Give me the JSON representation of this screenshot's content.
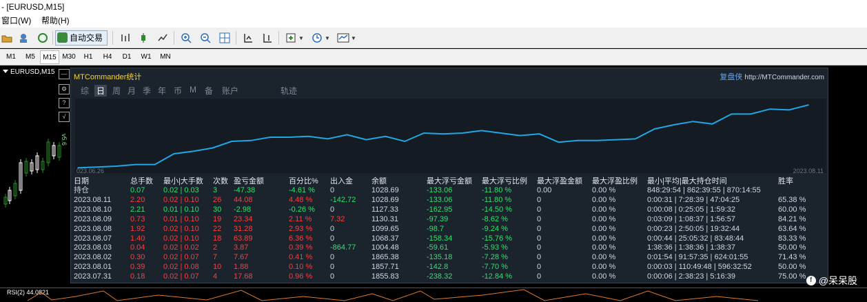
{
  "window": {
    "title": "- [EURUSD,M15]"
  },
  "menu": {
    "items": [
      {
        "label": "窗口(W)"
      },
      {
        "label": "帮助(H)"
      }
    ]
  },
  "toolbar": {
    "autotrade_label": "自动交易"
  },
  "timeframes": [
    "M1",
    "M5",
    "M15",
    "M30",
    "H1",
    "H4",
    "D1",
    "W1",
    "MN"
  ],
  "selected_timeframe": "M15",
  "chart": {
    "symbol_label": "EURUSD,M15",
    "vertical_text": "v5.6",
    "rsi_label": "RSI(2) 44.0821"
  },
  "panel": {
    "title": "MTCommander统计",
    "brand": "复盘侠",
    "brand_url": "http://MTCommander.com",
    "tabs": [
      "综",
      "日",
      "周",
      "月",
      "季",
      "年",
      "币",
      "M",
      "备",
      "账户",
      "轨迹"
    ],
    "active_tab": "日",
    "x_start": "023.06.26",
    "x_end": "2023.08.11"
  },
  "chart_data": {
    "type": "line",
    "x": [
      "2023.06.26",
      "2023.08.11"
    ],
    "values": [
      3,
      4,
      5,
      7,
      7,
      20,
      23,
      27,
      35,
      36,
      40,
      40,
      41,
      38,
      43,
      37,
      41,
      35,
      45,
      44,
      45,
      48,
      45,
      42,
      44,
      34,
      36,
      36,
      37,
      38,
      50,
      55,
      59,
      56,
      68,
      68,
      74,
      73,
      79
    ],
    "color": "#1fa7e6"
  },
  "table": {
    "headers": [
      "日期",
      "总手数",
      "最小|大手数",
      "次数",
      "盈亏金额",
      "百分比%",
      "出入金",
      "余额",
      "最大浮亏金额",
      "最大浮亏比例",
      "最大浮盈金额",
      "最大浮盈比例",
      "最小|平均|最大持仓时间",
      "胜率"
    ],
    "rows": [
      {
        "date": "持仓",
        "lots": "0.07",
        "minmax": "0.02 | 0.03",
        "count": "3",
        "pnl": "-47.38",
        "pct": "-4.61 %",
        "flow": "0",
        "balance": "1028.69",
        "maxloss": "-133.06",
        "maxlosspct": "-11.80 %",
        "maxprofit": "0.00",
        "maxprofitpct": "0.00 %",
        "hold": "848:29:54 | 862:39:55 | 870:14:55",
        "win": "",
        "color": "g"
      },
      {
        "date": "2023.08.11",
        "lots": "2.20",
        "minmax": "0.02 | 0.10",
        "count": "26",
        "pnl": "44.08",
        "pct": "4.48 %",
        "flow": "-142.72",
        "balance": "1028.69",
        "maxloss": "-133.06",
        "maxlosspct": "-11.80 %",
        "maxprofit": "0",
        "maxprofitpct": "0.00 %",
        "hold": "0:00:31 | 7:28:39 | 47:04:25",
        "win": "65.38 %",
        "color": "r"
      },
      {
        "date": "2023.08.10",
        "lots": "2.21",
        "minmax": "0.01 | 0.10",
        "count": "30",
        "pnl": "-2.98",
        "pct": "-0.26 %",
        "flow": "0",
        "balance": "1127.33",
        "maxloss": "-162.95",
        "maxlosspct": "-14.50 %",
        "maxprofit": "0",
        "maxprofitpct": "0.00 %",
        "hold": "0:00:08 | 0:25:05 | 1:59:32",
        "win": "60.00 %",
        "color": "g"
      },
      {
        "date": "2023.08.09",
        "lots": "0.73",
        "minmax": "0.01 | 0.10",
        "count": "19",
        "pnl": "23.34",
        "pct": "2.11 %",
        "flow": "7.32",
        "balance": "1130.31",
        "maxloss": "-97.39",
        "maxlosspct": "-8.62 %",
        "maxprofit": "0",
        "maxprofitpct": "0.00 %",
        "hold": "0:03:09 | 1:08:37 | 1:56:57",
        "win": "84.21 %",
        "color": "r"
      },
      {
        "date": "2023.08.08",
        "lots": "1.92",
        "minmax": "0.02 | 0.10",
        "count": "22",
        "pnl": "31.28",
        "pct": "2.93 %",
        "flow": "0",
        "balance": "1099.65",
        "maxloss": "-98.7",
        "maxlosspct": "-9.24 %",
        "maxprofit": "0",
        "maxprofitpct": "0.00 %",
        "hold": "0:00:23 | 2:50:05 | 19:32:44",
        "win": "63.64 %",
        "color": "r"
      },
      {
        "date": "2023.08.07",
        "lots": "1.40",
        "minmax": "0.02 | 0.10",
        "count": "18",
        "pnl": "63.89",
        "pct": "6.36 %",
        "flow": "0",
        "balance": "1068.37",
        "maxloss": "-158.34",
        "maxlosspct": "-15.76 %",
        "maxprofit": "0",
        "maxprofitpct": "0.00 %",
        "hold": "0:00:44 | 25:05:32 | 83:48:44",
        "win": "83.33 %",
        "color": "r"
      },
      {
        "date": "2023.08.03",
        "lots": "0.04",
        "minmax": "0.02 | 0.02",
        "count": "2",
        "pnl": "3.87",
        "pct": "0.39 %",
        "flow": "-864.77",
        "balance": "1004.48",
        "maxloss": "-59.61",
        "maxlosspct": "-5.93 %",
        "maxprofit": "0",
        "maxprofitpct": "0.00 %",
        "hold": "1:38:36 | 1:38:36 | 1:38:37",
        "win": "50.00 %",
        "color": "r"
      },
      {
        "date": "2023.08.02",
        "lots": "0.30",
        "minmax": "0.02 | 0.07",
        "count": "7",
        "pnl": "7.67",
        "pct": "0.41 %",
        "flow": "0",
        "balance": "1865.38",
        "maxloss": "-135.18",
        "maxlosspct": "-7.28 %",
        "maxprofit": "0",
        "maxprofitpct": "0.00 %",
        "hold": "0:01:54 | 91:57:35 | 624:01:55",
        "win": "71.43 %",
        "color": "r"
      },
      {
        "date": "2023.08.01",
        "lots": "0.39",
        "minmax": "0.02 | 0.08",
        "count": "10",
        "pnl": "1.88",
        "pct": "0.10 %",
        "flow": "0",
        "balance": "1857.71",
        "maxloss": "-142.8",
        "maxlosspct": "-7.70 %",
        "maxprofit": "0",
        "maxprofitpct": "0.00 %",
        "hold": "0:00:03 | 110:49:48 | 596:32:52",
        "win": "50.00 %",
        "color": "r"
      },
      {
        "date": "2023.07.31",
        "lots": "0.18",
        "minmax": "0.02 | 0.07",
        "count": "4",
        "pnl": "17.68",
        "pct": "0.96 %",
        "flow": "0",
        "balance": "1855.83",
        "maxloss": "-238.32",
        "maxlosspct": "-12.84 %",
        "maxprofit": "0",
        "maxprofitpct": "0.00 %",
        "hold": "0:00:06 | 2:38:23 | 5:16:39",
        "win": "75.00 %",
        "color": "r"
      }
    ]
  },
  "watermark": "@呆呆股"
}
